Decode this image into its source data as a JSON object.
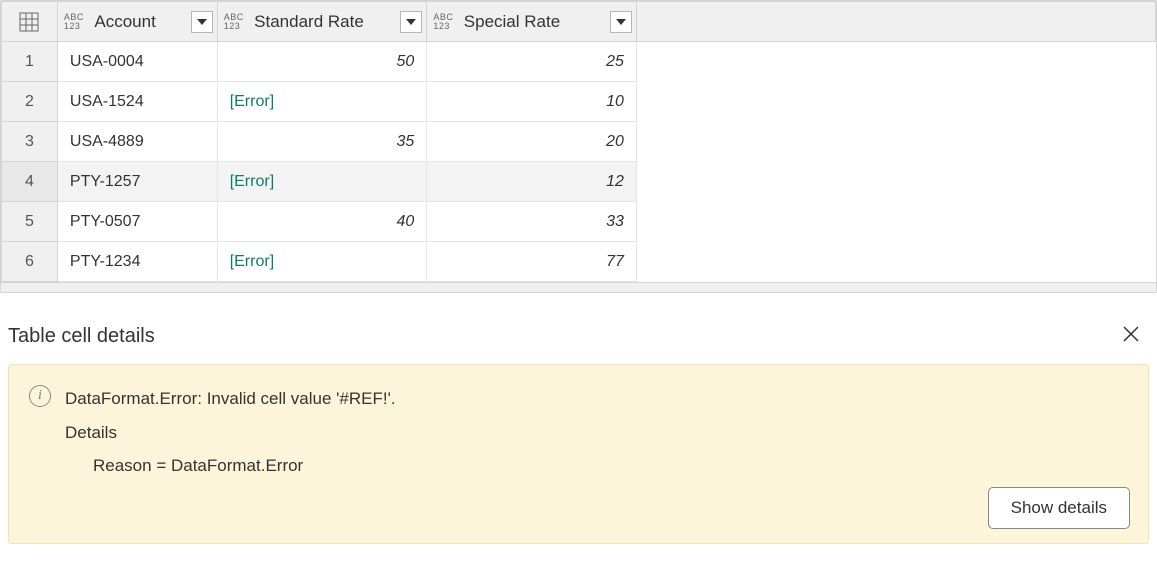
{
  "columns": {
    "account": "Account",
    "standard_rate": "Standard Rate",
    "special_rate": "Special Rate",
    "type_top": "ABC",
    "type_bot": "123"
  },
  "error_label": "[Error]",
  "rows": [
    {
      "n": "1",
      "account": "USA-0004",
      "std": "50",
      "std_err": false,
      "spc": "25"
    },
    {
      "n": "2",
      "account": "USA-1524",
      "std": "",
      "std_err": true,
      "spc": "10"
    },
    {
      "n": "3",
      "account": "USA-4889",
      "std": "35",
      "std_err": false,
      "spc": "20"
    },
    {
      "n": "4",
      "account": "PTY-1257",
      "std": "",
      "std_err": true,
      "spc": "12",
      "selected": true
    },
    {
      "n": "5",
      "account": "PTY-0507",
      "std": "40",
      "std_err": false,
      "spc": "33"
    },
    {
      "n": "6",
      "account": "PTY-1234",
      "std": "",
      "std_err": true,
      "spc": "77"
    }
  ],
  "chart_data": {
    "type": "table",
    "columns": [
      "Account",
      "Standard Rate",
      "Special Rate"
    ],
    "rows": [
      [
        "USA-0004",
        50,
        25
      ],
      [
        "USA-1524",
        "Error",
        10
      ],
      [
        "USA-4889",
        35,
        20
      ],
      [
        "PTY-1257",
        "Error",
        12
      ],
      [
        "PTY-0507",
        40,
        33
      ],
      [
        "PTY-1234",
        "Error",
        77
      ]
    ]
  },
  "details": {
    "title": "Table cell details",
    "error_line": "DataFormat.Error: Invalid cell value '#REF!'.",
    "details_label": "Details",
    "reason_line": "Reason = DataFormat.Error",
    "show_details": "Show details"
  }
}
